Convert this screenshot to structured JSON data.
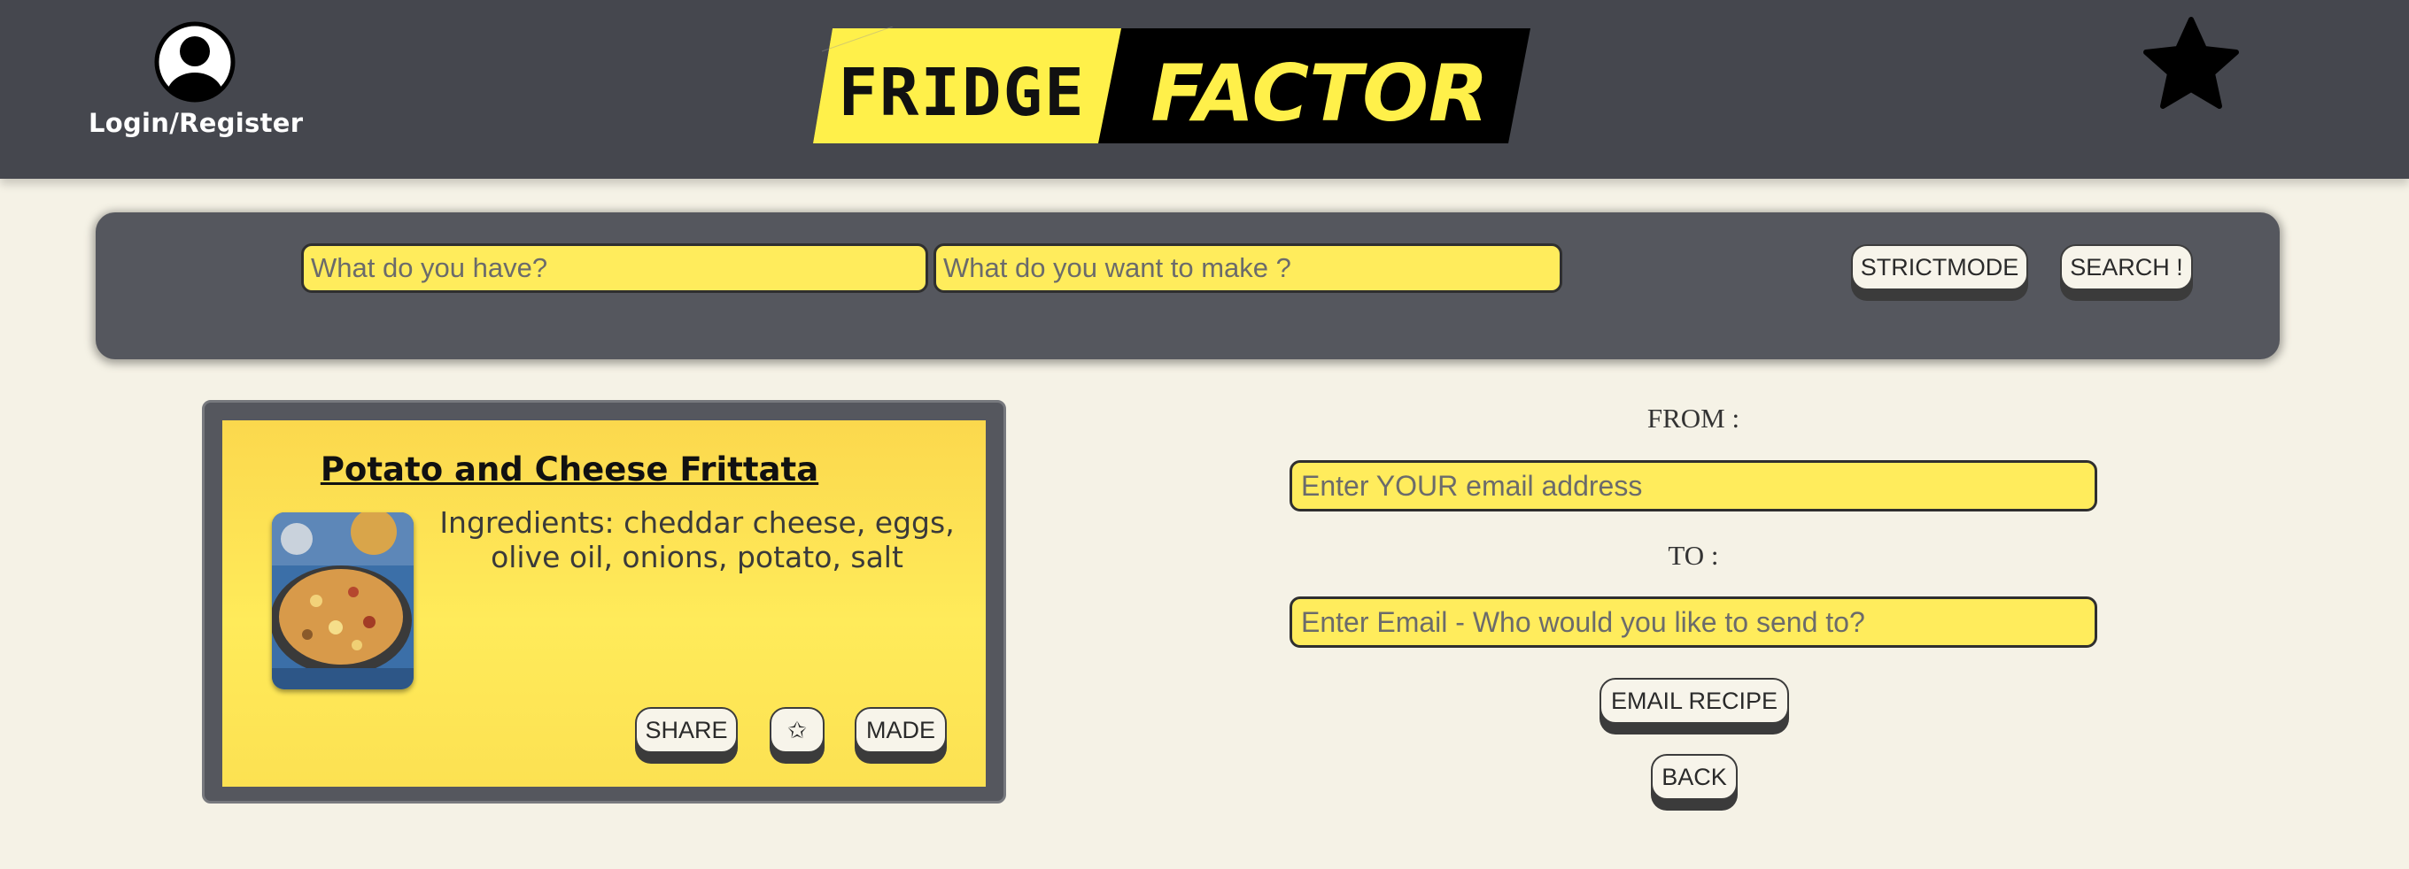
{
  "header": {
    "login_label": "Login/Register",
    "logo": {
      "left_word": "FRIDGE",
      "right_word": "FACTOR"
    }
  },
  "search": {
    "have_placeholder": "What do you have?",
    "make_placeholder": "What do you want to make ?",
    "strict_label": "STRICTMODE",
    "search_label": "SEARCH !"
  },
  "recipe": {
    "title": "Potato and Cheese Frittata",
    "ingredients_line1": "Ingredients: cheddar cheese, eggs,",
    "ingredients_line2": "olive oil, onions, potato, salt",
    "share_label": "SHARE",
    "favorite_glyph": "✩",
    "made_label": "MADE"
  },
  "email_form": {
    "from_label": "FROM :",
    "from_placeholder": "Enter YOUR email address",
    "to_label": "TO :",
    "to_placeholder": "Enter Email - Who would you like to send to?",
    "send_label": "EMAIL RECIPE",
    "back_label": "BACK"
  },
  "colors": {
    "header_bg": "#45474e",
    "page_bg": "#f5f2e6",
    "accent_yellow": "#ffec5c",
    "logo_yellow": "#fff04a"
  },
  "icons": {
    "user": "user-avatar-icon",
    "favorites": "star-icon"
  }
}
